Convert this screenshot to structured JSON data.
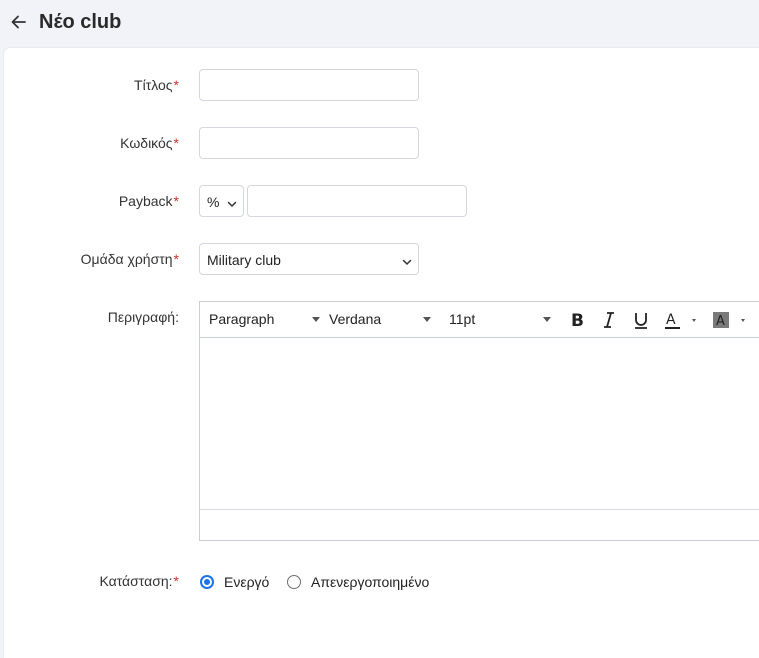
{
  "header": {
    "title": "Νέο club",
    "back_icon": "arrow-left-icon"
  },
  "form": {
    "title_label": "Τίτλος",
    "code_label": "Κωδικός",
    "payback_label": "Payback",
    "payback_unit": "%",
    "user_group_label": "Ομάδα χρήστη",
    "user_group_value": "Military club",
    "description_label": "Περιγραφή:",
    "status_label": "Κατάσταση:",
    "status_options": [
      "Ενεργό",
      "Απενεργοποιημένο"
    ],
    "status_selected": "Ενεργό",
    "required_mark": "*"
  },
  "editor": {
    "format": "Paragraph",
    "font": "Verdana",
    "size": "11pt",
    "buttons": [
      "bold-icon",
      "italic-icon",
      "underline-icon",
      "text-color-icon",
      "background-color-icon"
    ]
  },
  "colors": {
    "accent": "#1a73e8",
    "required": "#d32f2f",
    "background": "#f1f3f8"
  }
}
